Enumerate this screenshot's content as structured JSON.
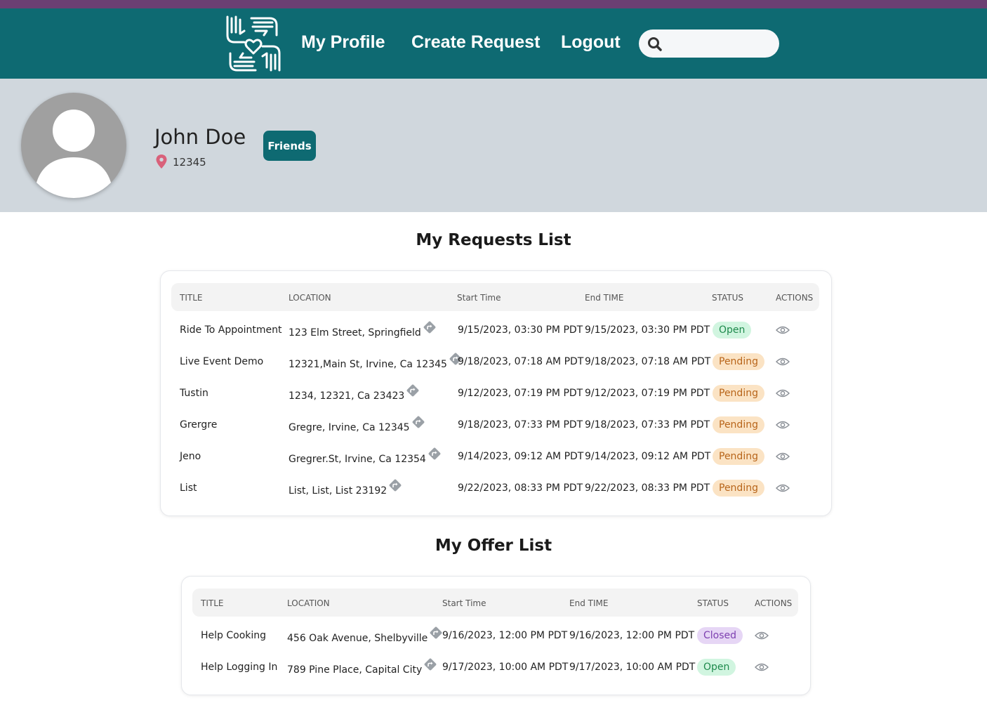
{
  "nav": {
    "links": [
      "My Profile",
      "Create Request",
      "Logout"
    ],
    "search_placeholder": ""
  },
  "profile": {
    "name": "John Doe",
    "zip": "12345",
    "friends_label": "Friends"
  },
  "requests": {
    "title": "My Requests List",
    "headers": [
      "TITLE",
      "LOCATION",
      "Start Time",
      "End TIME",
      "STATUS",
      "ACTIONS"
    ],
    "rows": [
      {
        "title": "Ride To Appointment",
        "location": "123 Elm Street, Springfield",
        "start": "9/15/2023, 03:30 PM PDT",
        "end": "9/15/2023, 03:30 PM PDT",
        "status": "Open"
      },
      {
        "title": "Live Event Demo",
        "location": "12321,Main St, Irvine, Ca 12345",
        "start": "9/18/2023, 07:18 AM PDT",
        "end": "9/18/2023, 07:18 AM PDT",
        "status": "Pending"
      },
      {
        "title": "Tustin",
        "location": "1234, 12321, Ca 23423",
        "start": "9/12/2023, 07:19 PM PDT",
        "end": "9/12/2023, 07:19 PM PDT",
        "status": "Pending"
      },
      {
        "title": "Grergre",
        "location": "Gregre, Irvine, Ca 12345",
        "start": "9/18/2023, 07:33 PM PDT",
        "end": "9/18/2023, 07:33 PM PDT",
        "status": "Pending"
      },
      {
        "title": "Jeno",
        "location": "Gregrer.St, Irvine, Ca 12354",
        "start": "9/14/2023, 09:12 AM PDT",
        "end": "9/14/2023, 09:12 AM PDT",
        "status": "Pending"
      },
      {
        "title": "List",
        "location": "List, List, List 23192",
        "start": "9/22/2023, 08:33 PM PDT",
        "end": "9/22/2023, 08:33 PM PDT",
        "status": "Pending"
      }
    ]
  },
  "offers": {
    "title": "My Offer List",
    "headers": [
      "TITLE",
      "LOCATION",
      "Start Time",
      "End TIME",
      "STATUS",
      "ACTIONS"
    ],
    "rows": [
      {
        "title": "Help Cooking",
        "location": "456 Oak Avenue, Shelbyville",
        "start": "9/16/2023, 12:00 PM PDT",
        "end": "9/16/2023, 12:00 PM PDT",
        "status": "Closed"
      },
      {
        "title": "Help Logging In",
        "location": "789 Pine Place, Capital City",
        "start": "9/17/2023, 10:00 AM PDT",
        "end": "9/17/2023, 10:00 AM PDT",
        "status": "Open"
      }
    ]
  },
  "colors": {
    "navbar": "#0e6a72",
    "top_strip": "#6b3f73",
    "profile_bg": "#d0d7dd",
    "pin": "#d9617a"
  },
  "icons": [
    "hands-heart-logo-icon",
    "search-icon",
    "location-pin-icon",
    "directions-icon",
    "eye-icon"
  ]
}
